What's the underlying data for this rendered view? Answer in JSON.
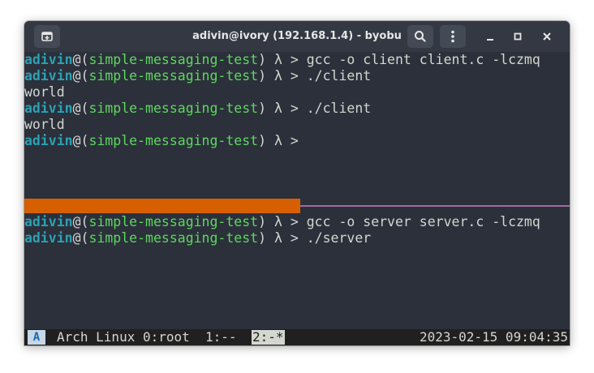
{
  "window": {
    "title": "adivin@ivory (192.168.1.4) - byobu"
  },
  "titlebar_icons": {
    "new_tab": "new-tab-icon",
    "search": "search-icon",
    "menu": "kebab-menu-icon",
    "minimize": "minimize-icon",
    "maximize": "maximize-icon",
    "close": "close-icon"
  },
  "prompt": {
    "user": "adivin",
    "at": "@(",
    "dir": "simple-messaging-test",
    "tail": ") λ > "
  },
  "top_pane": [
    {
      "type": "prompt",
      "cmd": "gcc -o client client.c -lczmq"
    },
    {
      "type": "prompt",
      "cmd": "./client"
    },
    {
      "type": "output",
      "text": "world"
    },
    {
      "type": "prompt",
      "cmd": "./client"
    },
    {
      "type": "output",
      "text": "world"
    },
    {
      "type": "prompt",
      "cmd": ""
    }
  ],
  "bottom_pane": [
    {
      "type": "prompt",
      "cmd": "gcc -o server server.c -lczmq"
    },
    {
      "type": "prompt",
      "cmd": "./server"
    }
  ],
  "statusbar": {
    "os_badge": "A",
    "host_info": "Arch Linux 0:root  1:--",
    "active_window": "2:-*",
    "datetime": "2023-02-15 09:04:35"
  },
  "colors": {
    "terminal_bg": "#2b303b",
    "user": "#2aa1b3",
    "dir": "#5fd75f",
    "splitter_active": "#d75f00",
    "splitter_line": "#a06aa0",
    "statusbar_bg": "#202020"
  }
}
